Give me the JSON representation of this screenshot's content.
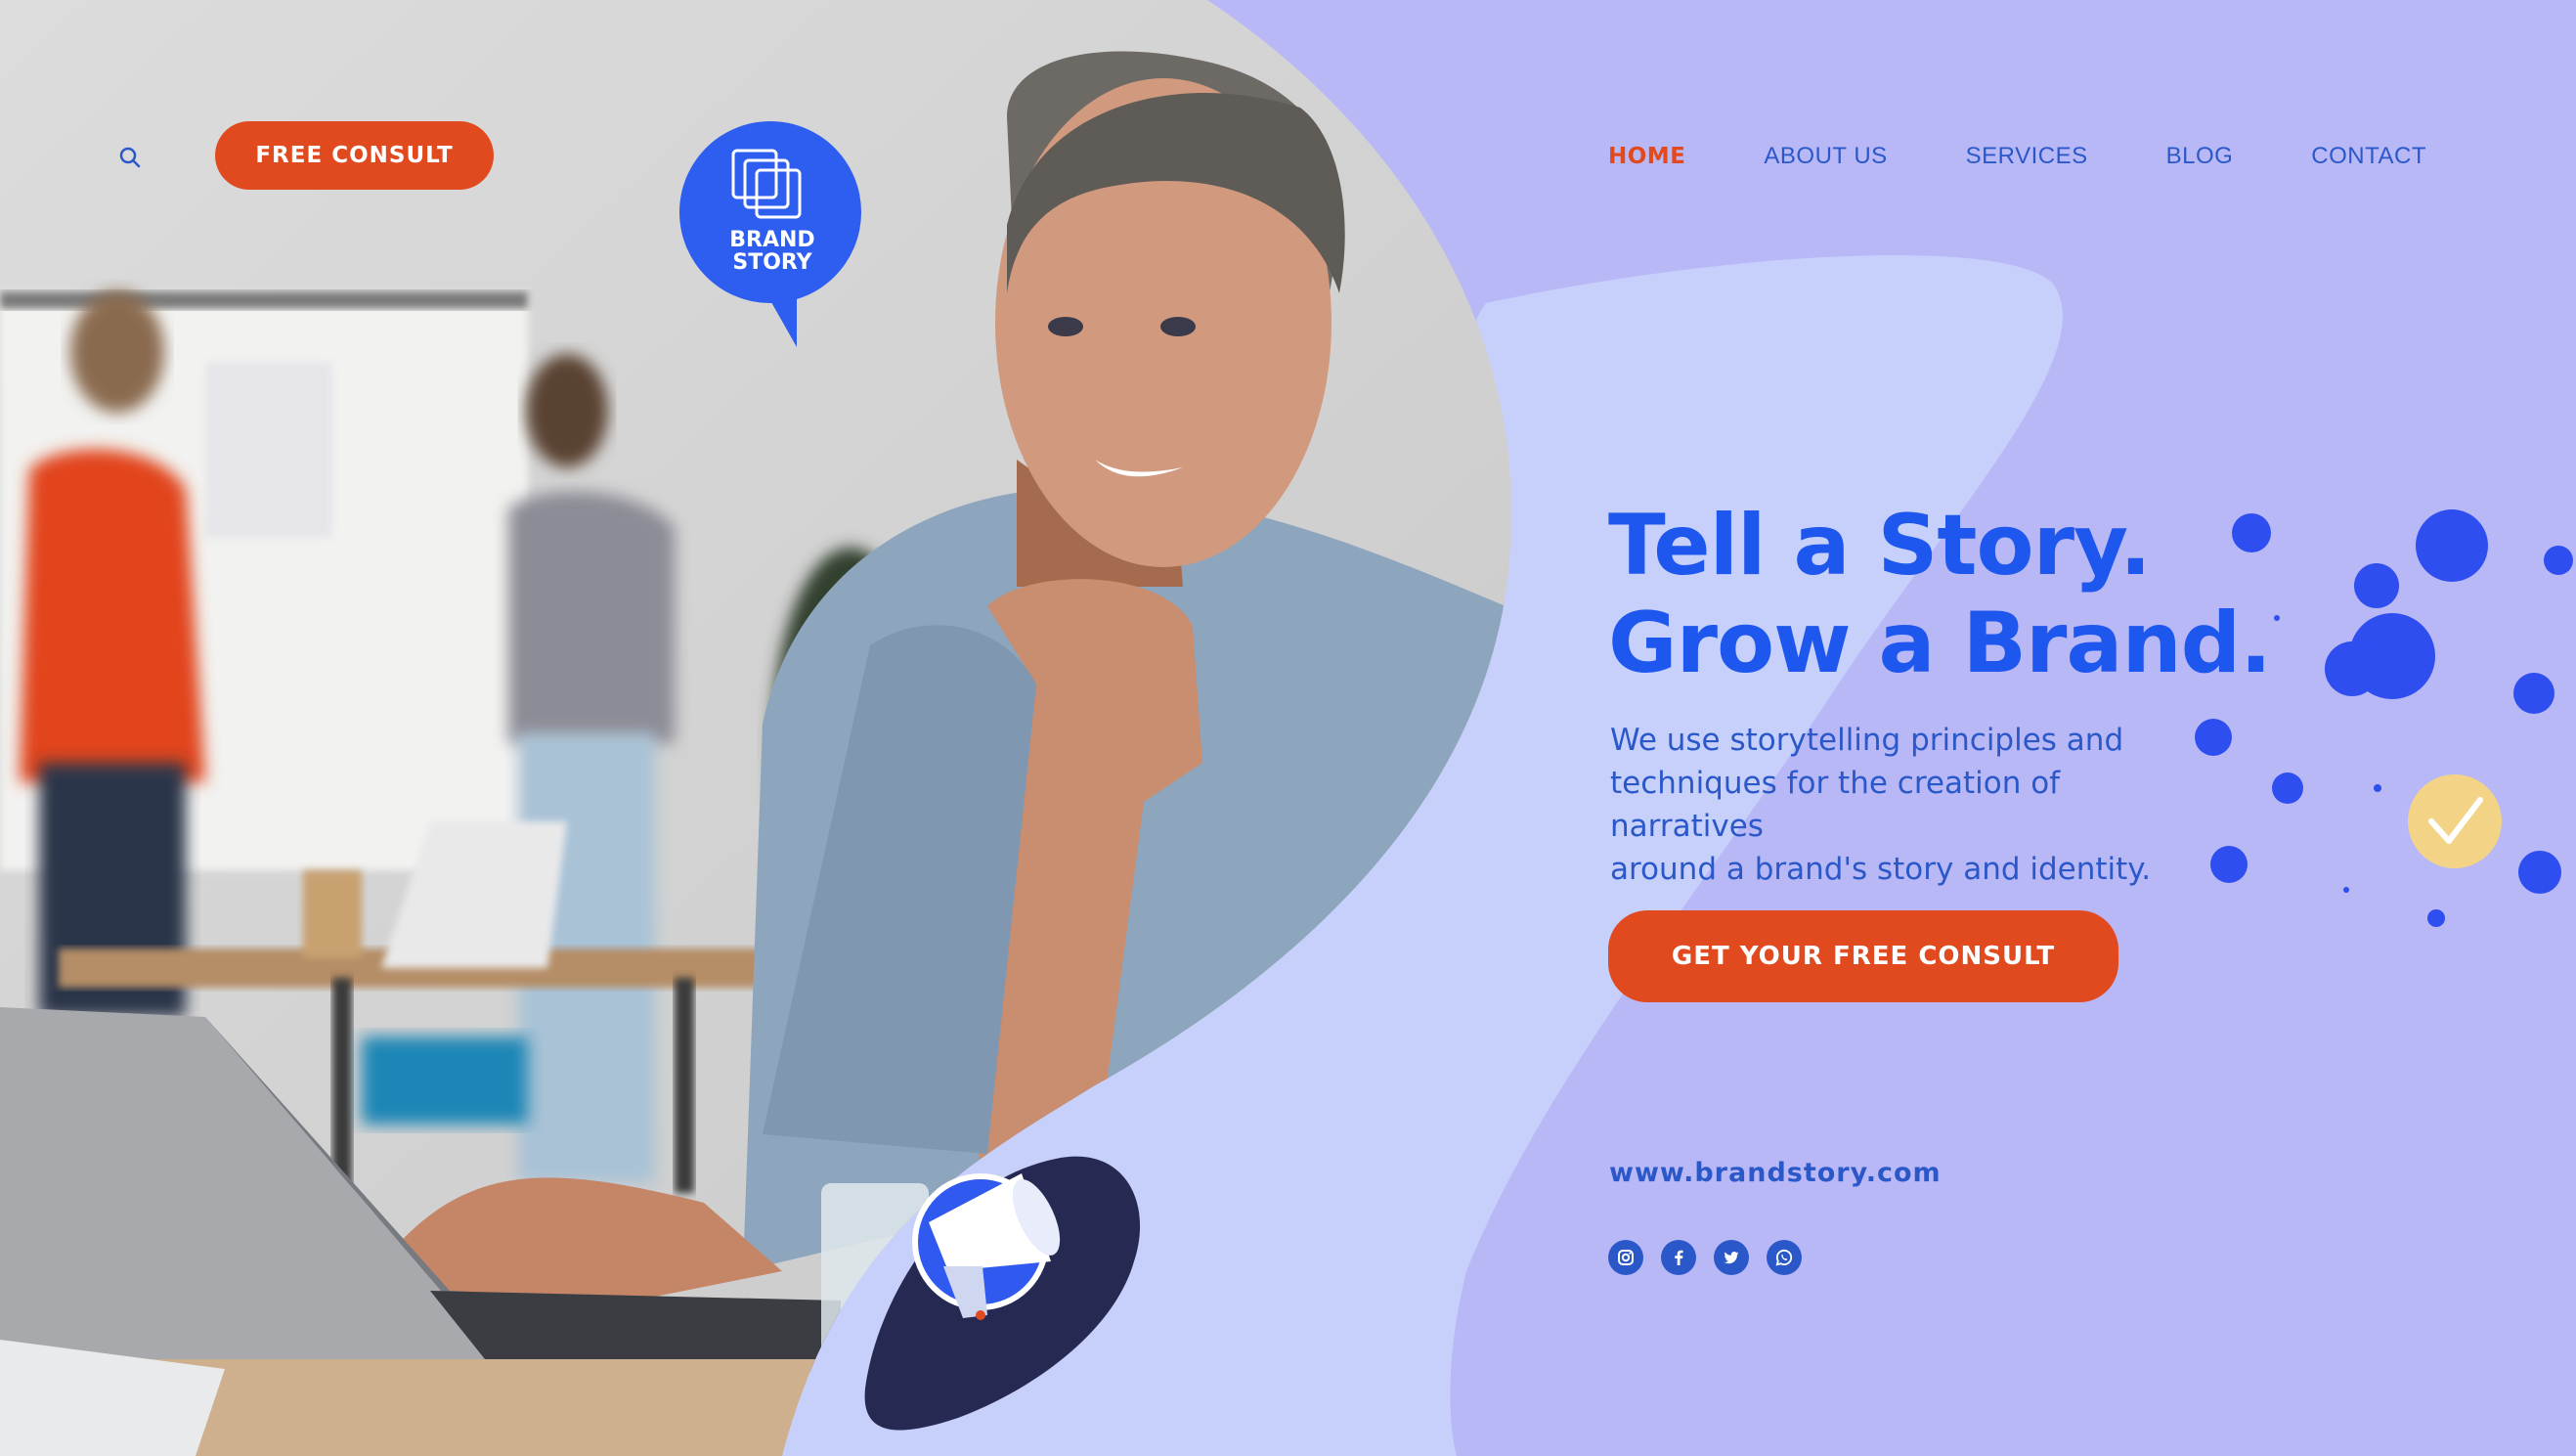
{
  "brand": {
    "logo_line1": "BRAND",
    "logo_line2": "STORY"
  },
  "header": {
    "consult_button": "FREE CONSULT",
    "nav": [
      "HOME",
      "ABOUT US",
      "SERVICES",
      "BLOG",
      "CONTACT"
    ],
    "active_nav": "HOME"
  },
  "hero": {
    "headline_line1": "Tell a Story.",
    "headline_line2": "Grow a Brand.",
    "description_lines": [
      "We use storytelling principles and",
      "techniques for the creation of narratives",
      "around a brand's story and identity."
    ],
    "cta_label": "GET YOUR FREE CONSULT"
  },
  "footer": {
    "website": "www.brandstory.com",
    "social_icons": [
      "instagram-icon",
      "facebook-icon",
      "twitter-icon",
      "whatsapp-icon"
    ]
  },
  "colors": {
    "accent_orange": "#e14a1f",
    "brand_blue": "#1e57ee",
    "nav_blue": "#2b58c9",
    "lavender_bg": "#b9b8f7",
    "light_blob": "#c7d0fb",
    "dark_navy": "#262a52",
    "check_yellow": "#f3d487"
  }
}
